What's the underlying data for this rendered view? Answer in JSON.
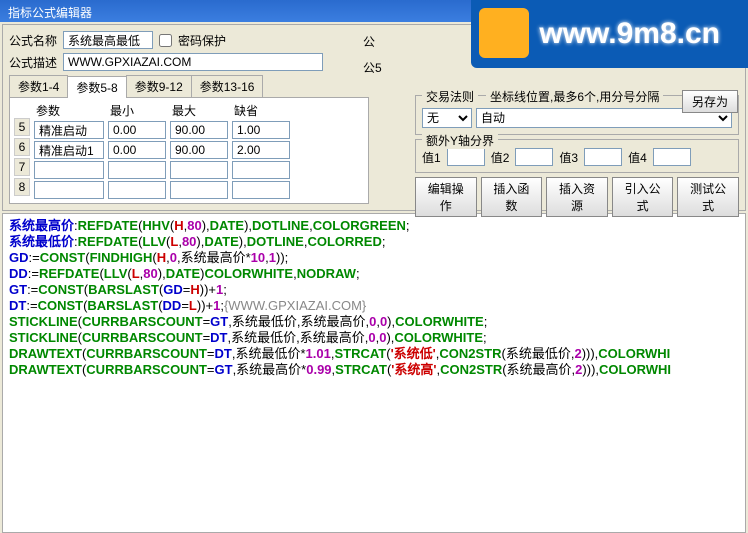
{
  "window": {
    "title": "指标公式编辑器"
  },
  "watermark": "www.9m8.cn",
  "form": {
    "name_label": "公式名称",
    "name_value": "系统最高最低",
    "pwd_label": "密码保护",
    "desc_label": "公式描述",
    "desc_value": "WWW.GPXIAZAI.COM",
    "hidden_lbl1": "公",
    "hidden_lbl2": "公5"
  },
  "tabs": [
    "参数1-4",
    "参数5-8",
    "参数9-12",
    "参数13-16"
  ],
  "tab_active": 1,
  "param_headers": [
    "参数",
    "最小",
    "最大",
    "缺省"
  ],
  "param_rows": [
    {
      "idx": "5",
      "name": "精准启动",
      "min": "0.00",
      "max": "90.00",
      "def": "1.00"
    },
    {
      "idx": "6",
      "name": "精准启动1",
      "min": "0.00",
      "max": "90.00",
      "def": "2.00"
    },
    {
      "idx": "7",
      "name": "",
      "min": "",
      "max": "",
      "def": ""
    },
    {
      "idx": "8",
      "name": "",
      "min": "",
      "max": "",
      "def": ""
    }
  ],
  "trade_rule": {
    "legend": "交易法则",
    "note": "坐标线位置,最多6个,用分号分隔",
    "sel1_value": "无",
    "sel2_value": "自动",
    "saveas": "另存为"
  },
  "extra_axis": {
    "legend": "额外Y轴分界",
    "labels": [
      "值1",
      "值2",
      "值3",
      "值4"
    ]
  },
  "buttons": [
    "编辑操作",
    "插入函数",
    "插入资源",
    "引入公式",
    "测试公式"
  ],
  "code": [
    [
      [
        "系统最高价",
        1
      ],
      [
        ":",
        0
      ],
      [
        "REFDATE",
        2
      ],
      [
        "(",
        0
      ],
      [
        "HHV",
        2
      ],
      [
        "(",
        0
      ],
      [
        "H",
        3
      ],
      [
        ",",
        0
      ],
      [
        "80",
        4
      ],
      [
        "),",
        0
      ],
      [
        "DATE",
        2
      ],
      [
        "),",
        0
      ],
      [
        "DOTLINE",
        2
      ],
      [
        ",",
        0
      ],
      [
        "COLORGREEN",
        2
      ],
      [
        ";",
        0
      ]
    ],
    [
      [
        "系统最低价",
        1
      ],
      [
        ":",
        0
      ],
      [
        "REFDATE",
        2
      ],
      [
        "(",
        0
      ],
      [
        "LLV",
        2
      ],
      [
        "(",
        0
      ],
      [
        "L",
        3
      ],
      [
        ",",
        0
      ],
      [
        "80",
        4
      ],
      [
        "),",
        0
      ],
      [
        "DATE",
        2
      ],
      [
        "),",
        0
      ],
      [
        "DOTLINE",
        2
      ],
      [
        ",",
        0
      ],
      [
        "COLORRED",
        2
      ],
      [
        ";",
        0
      ]
    ],
    [
      [
        "GD",
        1
      ],
      [
        ":=",
        0
      ],
      [
        "CONST",
        2
      ],
      [
        "(",
        0
      ],
      [
        "FINDHIGH",
        2
      ],
      [
        "(",
        0
      ],
      [
        "H",
        3
      ],
      [
        ",",
        0
      ],
      [
        "0",
        4
      ],
      [
        ",系统最高价*",
        0
      ],
      [
        "10",
        4
      ],
      [
        ",",
        0
      ],
      [
        "1",
        4
      ],
      [
        "));",
        0
      ]
    ],
    [
      [
        "DD",
        1
      ],
      [
        ":=",
        0
      ],
      [
        "REFDATE",
        2
      ],
      [
        "(",
        0
      ],
      [
        "LLV",
        2
      ],
      [
        "(",
        0
      ],
      [
        "L",
        3
      ],
      [
        ",",
        0
      ],
      [
        "80",
        4
      ],
      [
        "),",
        0
      ],
      [
        "DATE",
        2
      ],
      [
        ")",
        0
      ],
      [
        "COLORWHITE",
        2
      ],
      [
        ",",
        0
      ],
      [
        "NODRAW",
        2
      ],
      [
        ";",
        0
      ]
    ],
    [
      [
        "GT",
        1
      ],
      [
        ":=",
        0
      ],
      [
        "CONST",
        2
      ],
      [
        "(",
        0
      ],
      [
        "BARSLAST",
        2
      ],
      [
        "(",
        0
      ],
      [
        "GD",
        1
      ],
      [
        "=",
        0
      ],
      [
        "H",
        3
      ],
      [
        "))+",
        0
      ],
      [
        "1",
        4
      ],
      [
        ";",
        0
      ]
    ],
    [
      [
        "DT",
        1
      ],
      [
        ":=",
        0
      ],
      [
        "CONST",
        2
      ],
      [
        "(",
        0
      ],
      [
        "BARSLAST",
        2
      ],
      [
        "(",
        0
      ],
      [
        "DD",
        1
      ],
      [
        "=",
        0
      ],
      [
        "L",
        3
      ],
      [
        "))+",
        0
      ],
      [
        "1",
        4
      ],
      [
        ";",
        0
      ],
      [
        "{WWW.GPXIAZAI.COM}",
        5
      ]
    ],
    [
      [
        "STICKLINE",
        2
      ],
      [
        "(",
        0
      ],
      [
        "CURRBARSCOUNT",
        2
      ],
      [
        "=",
        0
      ],
      [
        "GT",
        1
      ],
      [
        ",系统最低价,系统最高价,",
        0
      ],
      [
        "0",
        4
      ],
      [
        ",",
        0
      ],
      [
        "0",
        4
      ],
      [
        "),",
        0
      ],
      [
        "COLORWHITE",
        2
      ],
      [
        ";",
        0
      ]
    ],
    [
      [
        "STICKLINE",
        2
      ],
      [
        "(",
        0
      ],
      [
        "CURRBARSCOUNT",
        2
      ],
      [
        "=",
        0
      ],
      [
        "DT",
        1
      ],
      [
        ",系统最低价,系统最高价,",
        0
      ],
      [
        "0",
        4
      ],
      [
        ",",
        0
      ],
      [
        "0",
        4
      ],
      [
        "),",
        0
      ],
      [
        "COLORWHITE",
        2
      ],
      [
        ";",
        0
      ]
    ],
    [
      [
        "DRAWTEXT",
        2
      ],
      [
        "(",
        0
      ],
      [
        "CURRBARSCOUNT",
        2
      ],
      [
        "=",
        0
      ],
      [
        "DT",
        1
      ],
      [
        ",系统最低价*",
        0
      ],
      [
        "1.01",
        4
      ],
      [
        ",",
        0
      ],
      [
        "STRCAT",
        2
      ],
      [
        "(",
        0
      ],
      [
        "'系统低'",
        3
      ],
      [
        ",",
        0
      ],
      [
        "CON2STR",
        2
      ],
      [
        "(系统最低价,",
        0
      ],
      [
        "2",
        4
      ],
      [
        "))),",
        0
      ],
      [
        "COLORWHI",
        2
      ]
    ],
    [
      [
        "DRAWTEXT",
        2
      ],
      [
        "(",
        0
      ],
      [
        "CURRBARSCOUNT",
        2
      ],
      [
        "=",
        0
      ],
      [
        "GT",
        1
      ],
      [
        ",系统最高价*",
        0
      ],
      [
        "0.99",
        4
      ],
      [
        ",",
        0
      ],
      [
        "STRCAT",
        2
      ],
      [
        "(",
        0
      ],
      [
        "'系统高'",
        3
      ],
      [
        ",",
        0
      ],
      [
        "CON2STR",
        2
      ],
      [
        "(系统最高价,",
        0
      ],
      [
        "2",
        4
      ],
      [
        "))),",
        0
      ],
      [
        "COLORWHI",
        2
      ]
    ]
  ]
}
